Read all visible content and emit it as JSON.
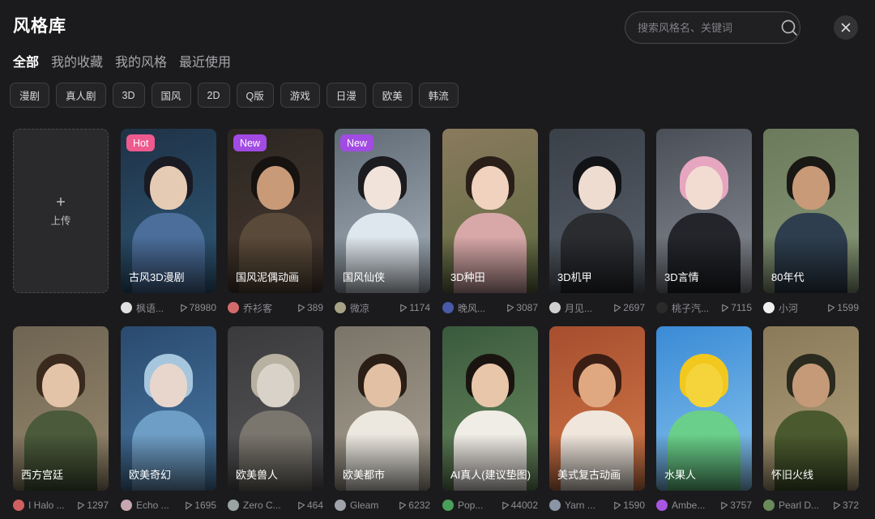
{
  "header": {
    "title": "风格库",
    "search_placeholder": "搜索风格名、关键词"
  },
  "tabs": [
    {
      "label": "全部",
      "active": true
    },
    {
      "label": "我的收藏",
      "active": false
    },
    {
      "label": "我的风格",
      "active": false
    },
    {
      "label": "最近使用",
      "active": false
    }
  ],
  "categories": [
    "漫剧",
    "真人剧",
    "3D",
    "国风",
    "2D",
    "Q版",
    "游戏",
    "日漫",
    "欧美",
    "韩流"
  ],
  "upload": {
    "label": "上传",
    "icon": "plus-icon"
  },
  "colors": {
    "background": "#1b1b1d",
    "hot_badge": "#ee5a8e",
    "new_badge": "#a24be3"
  },
  "cards": [
    {
      "name": "古风3D漫剧",
      "badge": "Hot",
      "author": "枫语...",
      "likes": "78980",
      "palette": [
        "#1f3246",
        "#2f5a7a",
        "#e5cbb4",
        "#1a1a22",
        "#4b6e9a"
      ],
      "avatar_color": "#e0e0e0"
    },
    {
      "name": "国风泥偶动画",
      "badge": "New",
      "author": "乔衫客",
      "likes": "389",
      "palette": [
        "#2b2622",
        "#4a3a30",
        "#c89a78",
        "#151210",
        "#5a4a3a"
      ],
      "avatar_color": "#d46a6a"
    },
    {
      "name": "国风仙侠",
      "badge": "New",
      "author": "微凉",
      "likes": "1174",
      "palette": [
        "#5f6a74",
        "#a9b4be",
        "#f1e3da",
        "#1b1b20",
        "#dfe7ee"
      ],
      "avatar_color": "#a7a286"
    },
    {
      "name": "3D种田",
      "badge": "",
      "author": "晚风...",
      "likes": "3087",
      "palette": [
        "#8a7a5e",
        "#5d6a3e",
        "#f0d2be",
        "#2a1e18",
        "#d8a8a8"
      ],
      "avatar_color": "#4a5aa8"
    },
    {
      "name": "3D机甲",
      "badge": "",
      "author": "月见...",
      "likes": "2697",
      "palette": [
        "#3a4048",
        "#5a626c",
        "#efdcd0",
        "#121316",
        "#2a2c30"
      ],
      "avatar_color": "#d0d0d0"
    },
    {
      "name": "3D言情",
      "badge": "",
      "author": "桃子汽...",
      "likes": "7115",
      "palette": [
        "#4a4e56",
        "#8a8e96",
        "#f2dcd2",
        "#e6a6c0",
        "#23252b"
      ],
      "avatar_color": "#2a2a2a"
    },
    {
      "name": "80年代",
      "badge": "",
      "author": "小河",
      "likes": "1599",
      "palette": [
        "#6a7a5a",
        "#8a9a7a",
        "#c89a78",
        "#1a1814",
        "#2e3e4e"
      ],
      "avatar_color": "#f0f0f0"
    },
    {
      "name": "西方宫廷",
      "badge": "",
      "author": "I Halo ...",
      "likes": "1297",
      "palette": [
        "#6e6452",
        "#9a8a6e",
        "#e4c4a8",
        "#3a2a1e",
        "#4a5a3a"
      ],
      "avatar_color": "#d06060"
    },
    {
      "name": "欧美奇幻",
      "badge": "",
      "author": "Echo ...",
      "likes": "1695",
      "palette": [
        "#2a4a6e",
        "#4a7aa6",
        "#e8d6cc",
        "#a6c6de",
        "#6e9ec6"
      ],
      "avatar_color": "#c8a8b0"
    },
    {
      "name": "欧美兽人",
      "badge": "",
      "author": "Zero C...",
      "likes": "464",
      "palette": [
        "#3a3a3c",
        "#5a5a5c",
        "#d8d2c8",
        "#b8b0a0",
        "#7a766e"
      ],
      "avatar_color": "#9aa4a0"
    },
    {
      "name": "欧美都市",
      "badge": "",
      "author": "Gleam",
      "likes": "6232",
      "palette": [
        "#7a7468",
        "#a8a092",
        "#e2c0a4",
        "#2a1e16",
        "#ece8e0"
      ],
      "avatar_color": "#a0a4aa"
    },
    {
      "name": "AI真人(建议垫图)",
      "badge": "",
      "author": "Pop...",
      "likes": "44002",
      "palette": [
        "#3a5a3e",
        "#6a8a5e",
        "#e8c6aa",
        "#1a1410",
        "#f0ece6"
      ],
      "avatar_color": "#4aa05a"
    },
    {
      "name": "美式复古动画",
      "badge": "",
      "author": "Yarn ...",
      "likes": "1590",
      "palette": [
        "#a64e2e",
        "#d47a4a",
        "#e0a880",
        "#3a1e14",
        "#f0e6dc"
      ],
      "avatar_color": "#8a96a6"
    },
    {
      "name": "水果人",
      "badge": "",
      "author": "Ambe...",
      "likes": "3757",
      "palette": [
        "#3a8ad6",
        "#8ac6ee",
        "#f4d43a",
        "#f2c81e",
        "#6acf8a"
      ],
      "avatar_color": "#a855e0"
    },
    {
      "name": "怀旧火线",
      "badge": "",
      "author": "Pearl D...",
      "likes": "372",
      "palette": [
        "#8a7a5a",
        "#b0a07a",
        "#c49a78",
        "#2a2a1e",
        "#4a5a2e"
      ],
      "avatar_color": "#6a8a5a"
    }
  ]
}
